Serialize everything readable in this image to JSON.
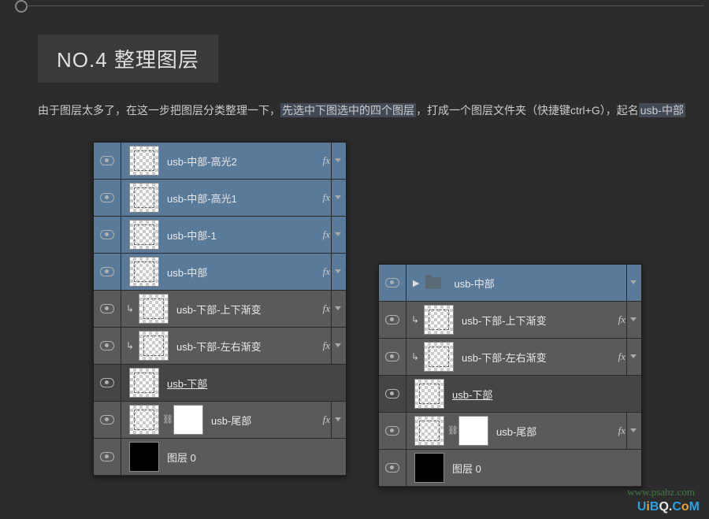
{
  "section": {
    "title": "NO.4 整理图层"
  },
  "desc": {
    "t1": "由于图层太多了，在这一步把图层分类整理一下，",
    "hl1": "先选中下图选中的四个图层",
    "t2": "，打成一个图层文件夹（快捷键ctrl+G），起名",
    "hl2": "usb-中部"
  },
  "left": {
    "layers": [
      {
        "name": "usb-中部-高光2",
        "sel": "blue",
        "clip": false,
        "link": false,
        "thumb": "checker",
        "fx": true,
        "arr": true
      },
      {
        "name": "usb-中部-高光1",
        "sel": "blue",
        "clip": false,
        "link": false,
        "thumb": "checker",
        "fx": true,
        "arr": true
      },
      {
        "name": "usb-中部-1",
        "sel": "blue",
        "clip": false,
        "link": false,
        "thumb": "checker",
        "fx": true,
        "arr": true
      },
      {
        "name": "usb-中部",
        "sel": "blue",
        "clip": false,
        "link": false,
        "thumb": "checker",
        "fx": true,
        "arr": true
      },
      {
        "name": "usb-下部-上下渐变",
        "sel": "grey",
        "clip": true,
        "link": false,
        "thumb": "checker",
        "fx": true,
        "arr": true
      },
      {
        "name": "usb-下部-左右渐变",
        "sel": "grey",
        "clip": true,
        "link": false,
        "thumb": "checker",
        "fx": true,
        "arr": true
      },
      {
        "name": "usb-下部",
        "sel": "none",
        "clip": false,
        "link": false,
        "thumb": "checker",
        "underline": true,
        "fx": false,
        "arr": false
      },
      {
        "name": "usb-尾部",
        "sel": "grey",
        "clip": false,
        "link": true,
        "thumb": "checker",
        "mask": true,
        "fx": true,
        "arr": true
      },
      {
        "name": "图层 0",
        "sel": "grey",
        "clip": false,
        "link": false,
        "thumb": "black",
        "fx": false,
        "arr": false
      }
    ]
  },
  "right": {
    "layers": [
      {
        "type": "folder",
        "name": "usb-中部",
        "sel": "blue",
        "arr": true
      },
      {
        "name": "usb-下部-上下渐变",
        "sel": "grey",
        "clip": true,
        "thumb": "checker",
        "fx": true,
        "arr": true
      },
      {
        "name": "usb-下部-左右渐变",
        "sel": "grey",
        "clip": true,
        "thumb": "checker",
        "fx": true,
        "arr": true
      },
      {
        "name": "usb-下部",
        "sel": "none",
        "clip": false,
        "thumb": "checker",
        "underline": true,
        "fx": false,
        "arr": false
      },
      {
        "name": "usb-尾部",
        "sel": "grey",
        "clip": false,
        "link": true,
        "thumb": "checker",
        "mask": true,
        "fx": true,
        "arr": true
      },
      {
        "name": "图层 0",
        "sel": "grey",
        "clip": false,
        "thumb": "black",
        "fx": false,
        "arr": false
      }
    ]
  },
  "watermark": {
    "w1": "www.psahz.com",
    "w2_a": "U",
    "w2_b": "i",
    "w2_c": "B",
    "w2_d": "Q.",
    "w2_e": "C",
    "w2_f": "o",
    "w2_g": "M"
  }
}
